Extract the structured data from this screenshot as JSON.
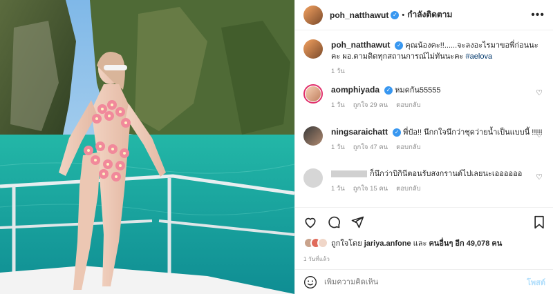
{
  "header": {
    "username": "poh_natthawut",
    "separator": "•",
    "follow_status": "กำลังติดตาม",
    "more": "•••"
  },
  "caption": {
    "username": "poh_natthawut",
    "text": "คุณน้องคะ!!......จะลงอะไรมาขอพี่ก่อนนะคะ ผอ.ตามติดทุกสถานการณ์ไม่ทันนะคะ ",
    "hashtag": "#aelova",
    "time": "1 วัน"
  },
  "comments": [
    {
      "username": "aomphiyada",
      "text": "หมดกัน55555",
      "time": "1 วัน",
      "likes": "ถูกใจ 29 คน",
      "reply": "ตอบกลับ"
    },
    {
      "username": "ningsaraichatt",
      "text": "พี่ป๋อ!! นึกกใจนึกว่าชุดว่ายน้ำเป็นแบบนี้ !!!!!",
      "time": "1 วัน",
      "likes": "ถูกใจ 47 คน",
      "reply": "ตอบกลับ"
    },
    {
      "username": "",
      "text": "ก็นึกว่าบิกินีตอนรับสงกรานต์ไปเลยนะเออออออ",
      "time": "1 วัน",
      "likes": "ถูกใจ 15 คน",
      "reply": "ตอบกลับ"
    }
  ],
  "likes": {
    "prefix": "ถูกใจโดย",
    "user": "jariya.anfone",
    "and": "และ",
    "others": "คนอื่นๆ อีก 49,078 คน"
  },
  "post_time": "1 วันที่แล้ว",
  "add_comment": {
    "placeholder": "เพิ่มความคิดเห็น",
    "post_label": "โพสต์"
  },
  "icons": [
    "more-icon",
    "verified-icon",
    "heart-icon",
    "comment-icon",
    "share-icon",
    "save-icon",
    "emoji-icon"
  ],
  "colors": {
    "verified": "#3897f0",
    "hashtag": "#00376b",
    "post_button": "#b2dffc",
    "muted": "#8e8e8e"
  }
}
